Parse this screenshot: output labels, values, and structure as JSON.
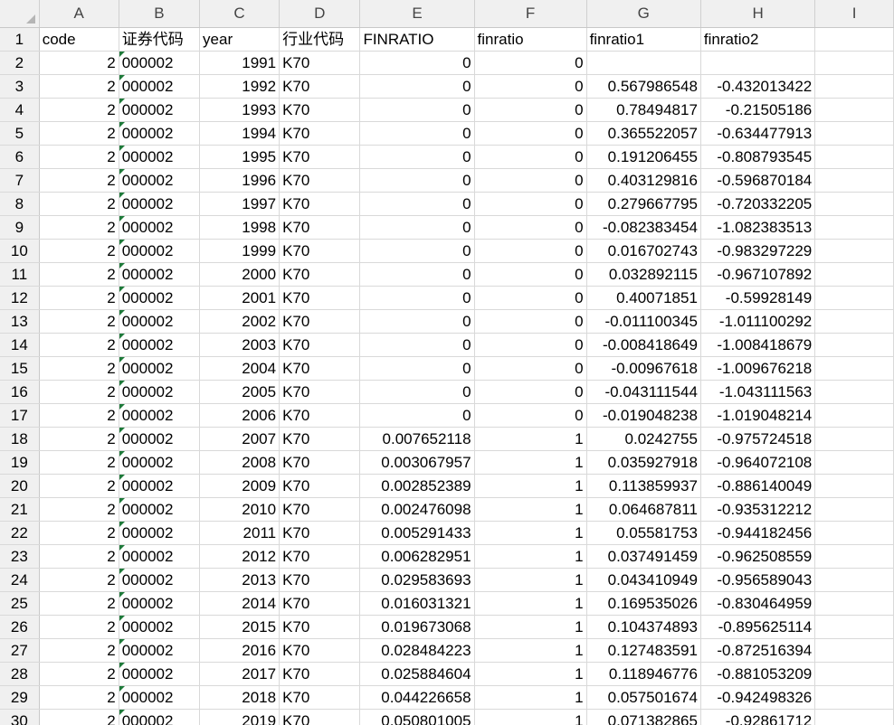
{
  "columns": [
    "A",
    "B",
    "C",
    "D",
    "E",
    "F",
    "G",
    "H",
    "I"
  ],
  "header_row": {
    "row_number": "1",
    "cells": [
      "code",
      "证券代码",
      "year",
      "行业代码",
      "FINRATIO",
      "finratio",
      "finratio1",
      "finratio2",
      ""
    ]
  },
  "rows": [
    {
      "n": "2",
      "code": "2",
      "sec": "000002",
      "year": "1991",
      "ind": "K70",
      "FINRATIO": "0",
      "finratio": "0",
      "f1": "",
      "f2": ""
    },
    {
      "n": "3",
      "code": "2",
      "sec": "000002",
      "year": "1992",
      "ind": "K70",
      "FINRATIO": "0",
      "finratio": "0",
      "f1": "0.567986548",
      "f2": "-0.432013422"
    },
    {
      "n": "4",
      "code": "2",
      "sec": "000002",
      "year": "1993",
      "ind": "K70",
      "FINRATIO": "0",
      "finratio": "0",
      "f1": "0.78494817",
      "f2": "-0.21505186"
    },
    {
      "n": "5",
      "code": "2",
      "sec": "000002",
      "year": "1994",
      "ind": "K70",
      "FINRATIO": "0",
      "finratio": "0",
      "f1": "0.365522057",
      "f2": "-0.634477913"
    },
    {
      "n": "6",
      "code": "2",
      "sec": "000002",
      "year": "1995",
      "ind": "K70",
      "FINRATIO": "0",
      "finratio": "0",
      "f1": "0.191206455",
      "f2": "-0.808793545"
    },
    {
      "n": "7",
      "code": "2",
      "sec": "000002",
      "year": "1996",
      "ind": "K70",
      "FINRATIO": "0",
      "finratio": "0",
      "f1": "0.403129816",
      "f2": "-0.596870184"
    },
    {
      "n": "8",
      "code": "2",
      "sec": "000002",
      "year": "1997",
      "ind": "K70",
      "FINRATIO": "0",
      "finratio": "0",
      "f1": "0.279667795",
      "f2": "-0.720332205"
    },
    {
      "n": "9",
      "code": "2",
      "sec": "000002",
      "year": "1998",
      "ind": "K70",
      "FINRATIO": "0",
      "finratio": "0",
      "f1": "-0.082383454",
      "f2": "-1.082383513"
    },
    {
      "n": "10",
      "code": "2",
      "sec": "000002",
      "year": "1999",
      "ind": "K70",
      "FINRATIO": "0",
      "finratio": "0",
      "f1": "0.016702743",
      "f2": "-0.983297229"
    },
    {
      "n": "11",
      "code": "2",
      "sec": "000002",
      "year": "2000",
      "ind": "K70",
      "FINRATIO": "0",
      "finratio": "0",
      "f1": "0.032892115",
      "f2": "-0.967107892"
    },
    {
      "n": "12",
      "code": "2",
      "sec": "000002",
      "year": "2001",
      "ind": "K70",
      "FINRATIO": "0",
      "finratio": "0",
      "f1": "0.40071851",
      "f2": "-0.59928149"
    },
    {
      "n": "13",
      "code": "2",
      "sec": "000002",
      "year": "2002",
      "ind": "K70",
      "FINRATIO": "0",
      "finratio": "0",
      "f1": "-0.011100345",
      "f2": "-1.011100292"
    },
    {
      "n": "14",
      "code": "2",
      "sec": "000002",
      "year": "2003",
      "ind": "K70",
      "FINRATIO": "0",
      "finratio": "0",
      "f1": "-0.008418649",
      "f2": "-1.008418679"
    },
    {
      "n": "15",
      "code": "2",
      "sec": "000002",
      "year": "2004",
      "ind": "K70",
      "FINRATIO": "0",
      "finratio": "0",
      "f1": "-0.00967618",
      "f2": "-1.009676218"
    },
    {
      "n": "16",
      "code": "2",
      "sec": "000002",
      "year": "2005",
      "ind": "K70",
      "FINRATIO": "0",
      "finratio": "0",
      "f1": "-0.043111544",
      "f2": "-1.043111563"
    },
    {
      "n": "17",
      "code": "2",
      "sec": "000002",
      "year": "2006",
      "ind": "K70",
      "FINRATIO": "0",
      "finratio": "0",
      "f1": "-0.019048238",
      "f2": "-1.019048214"
    },
    {
      "n": "18",
      "code": "2",
      "sec": "000002",
      "year": "2007",
      "ind": "K70",
      "FINRATIO": "0.007652118",
      "finratio": "1",
      "f1": "0.0242755",
      "f2": "-0.975724518"
    },
    {
      "n": "19",
      "code": "2",
      "sec": "000002",
      "year": "2008",
      "ind": "K70",
      "FINRATIO": "0.003067957",
      "finratio": "1",
      "f1": "0.035927918",
      "f2": "-0.964072108"
    },
    {
      "n": "20",
      "code": "2",
      "sec": "000002",
      "year": "2009",
      "ind": "K70",
      "FINRATIO": "0.002852389",
      "finratio": "1",
      "f1": "0.113859937",
      "f2": "-0.886140049"
    },
    {
      "n": "21",
      "code": "2",
      "sec": "000002",
      "year": "2010",
      "ind": "K70",
      "FINRATIO": "0.002476098",
      "finratio": "1",
      "f1": "0.064687811",
      "f2": "-0.935312212"
    },
    {
      "n": "22",
      "code": "2",
      "sec": "000002",
      "year": "2011",
      "ind": "K70",
      "FINRATIO": "0.005291433",
      "finratio": "1",
      "f1": "0.05581753",
      "f2": "-0.944182456"
    },
    {
      "n": "23",
      "code": "2",
      "sec": "000002",
      "year": "2012",
      "ind": "K70",
      "FINRATIO": "0.006282951",
      "finratio": "1",
      "f1": "0.037491459",
      "f2": "-0.962508559"
    },
    {
      "n": "24",
      "code": "2",
      "sec": "000002",
      "year": "2013",
      "ind": "K70",
      "FINRATIO": "0.029583693",
      "finratio": "1",
      "f1": "0.043410949",
      "f2": "-0.956589043"
    },
    {
      "n": "25",
      "code": "2",
      "sec": "000002",
      "year": "2014",
      "ind": "K70",
      "FINRATIO": "0.016031321",
      "finratio": "1",
      "f1": "0.169535026",
      "f2": "-0.830464959"
    },
    {
      "n": "26",
      "code": "2",
      "sec": "000002",
      "year": "2015",
      "ind": "K70",
      "FINRATIO": "0.019673068",
      "finratio": "1",
      "f1": "0.104374893",
      "f2": "-0.895625114"
    },
    {
      "n": "27",
      "code": "2",
      "sec": "000002",
      "year": "2016",
      "ind": "K70",
      "FINRATIO": "0.028484223",
      "finratio": "1",
      "f1": "0.127483591",
      "f2": "-0.872516394"
    },
    {
      "n": "28",
      "code": "2",
      "sec": "000002",
      "year": "2017",
      "ind": "K70",
      "FINRATIO": "0.025884604",
      "finratio": "1",
      "f1": "0.118946776",
      "f2": "-0.881053209"
    },
    {
      "n": "29",
      "code": "2",
      "sec": "000002",
      "year": "2018",
      "ind": "K70",
      "FINRATIO": "0.044226658",
      "finratio": "1",
      "f1": "0.057501674",
      "f2": "-0.942498326"
    },
    {
      "n": "30",
      "code": "2",
      "sec": "000002",
      "year": "2019",
      "ind": "K70",
      "FINRATIO": "0.050801005",
      "finratio": "1",
      "f1": "0.071382865",
      "f2": "-0.92861712"
    }
  ],
  "colors": {
    "header_bg": "#f0f0f0",
    "gridline": "#d9d9d9",
    "text_number_flag": "#1e7a3a"
  }
}
